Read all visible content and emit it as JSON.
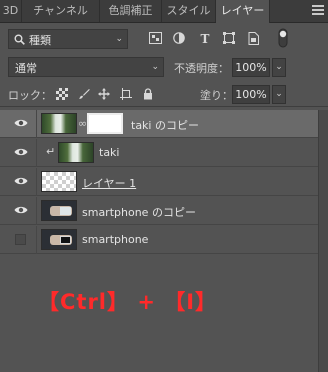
{
  "tabs": [
    {
      "label": "3D"
    },
    {
      "label": "チャンネル"
    },
    {
      "label": "色調補正"
    },
    {
      "label": "スタイル"
    },
    {
      "label": "レイヤー"
    }
  ],
  "filter": {
    "kind_label": "種類"
  },
  "blend": {
    "mode": "通常",
    "opacity_label": "不透明度：",
    "opacity_value": "100%"
  },
  "lock": {
    "label": "ロック：",
    "fill_label": "塗り：",
    "fill_value": "100%"
  },
  "layers": [
    {
      "name": "taki のコピー",
      "visible": true,
      "selected": true
    },
    {
      "name": "taki",
      "visible": true,
      "selected": false
    },
    {
      "name": "レイヤー 1",
      "visible": true,
      "selected": false
    },
    {
      "name": "smartphone のコピー",
      "visible": true,
      "selected": false
    },
    {
      "name": "smartphone",
      "visible": false,
      "selected": false
    }
  ],
  "overlay": {
    "shortcut_text": "【Ctrl】 + 【I】",
    "color": "#ff2a2a"
  },
  "icons": [
    "search-icon",
    "pixel-filter-icon",
    "adjustment-filter-icon",
    "type-filter-icon",
    "shape-filter-icon",
    "smartobject-filter-icon",
    "filter-toggle-icon",
    "lock-transparent-icon",
    "lock-brush-icon",
    "lock-move-icon",
    "lock-artboard-icon",
    "lock-all-icon",
    "eye-icon",
    "chain-link-icon",
    "clipping-arrow-icon",
    "panel-menu-icon"
  ]
}
